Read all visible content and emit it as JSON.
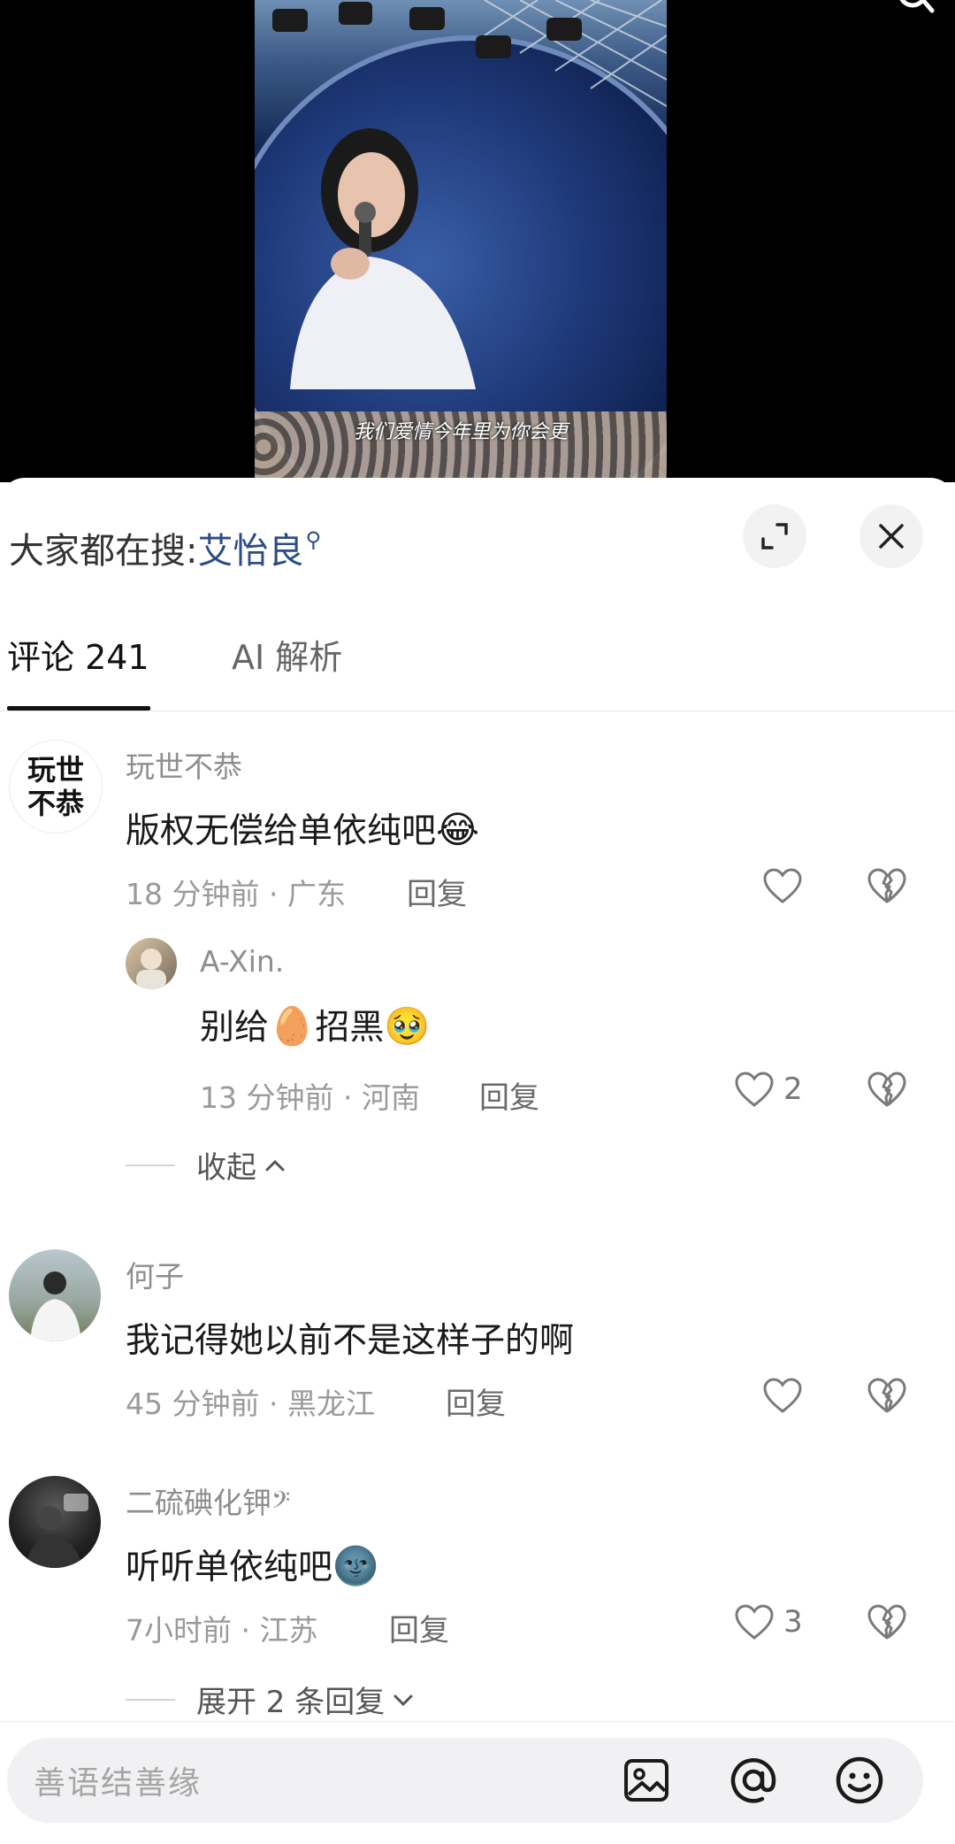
{
  "video": {
    "subtitle": "我们爱情今年里为你会更"
  },
  "panel": {
    "hot_search_prefix": "大家都在搜:",
    "hot_search_term": "艾怡良",
    "hot_search_icon": "search-icon",
    "expand_icon": "expand-icon",
    "close_icon": "close-icon"
  },
  "tabs": {
    "comments": "评论 241",
    "ai": "AI 解析"
  },
  "comments": [
    {
      "avatar_text": "玩世\n不恭",
      "username": "玩世不恭",
      "content": "版权无偿给单依纯吧",
      "emoji": "😂",
      "meta": "18 分钟前 · 广东",
      "reply_label": "回复",
      "likes": "",
      "replies": [
        {
          "username": "A-Xin.",
          "content_before": "别给",
          "emoji_mid": "🥚",
          "content_after": "招黑",
          "emoji": "🥹",
          "meta": "13 分钟前 · 河南",
          "reply_label": "回复",
          "likes": "2"
        }
      ],
      "collapse_label": "收起"
    },
    {
      "username": "何子",
      "content": "我记得她以前不是这样子的啊",
      "meta": "45 分钟前 · 黑龙江",
      "reply_label": "回复",
      "likes": ""
    },
    {
      "username": "二硫碘化钾𝄢",
      "content": "听听单依纯吧",
      "emoji": "🌚",
      "meta": "7小时前 · 江苏",
      "reply_label": "回复",
      "likes": "3",
      "expand_label": "展开 2 条回复"
    }
  ],
  "input": {
    "placeholder": "善语结善缘",
    "image_icon": "image-icon",
    "at_icon": "at-icon",
    "emoji_icon": "emoji-icon"
  }
}
